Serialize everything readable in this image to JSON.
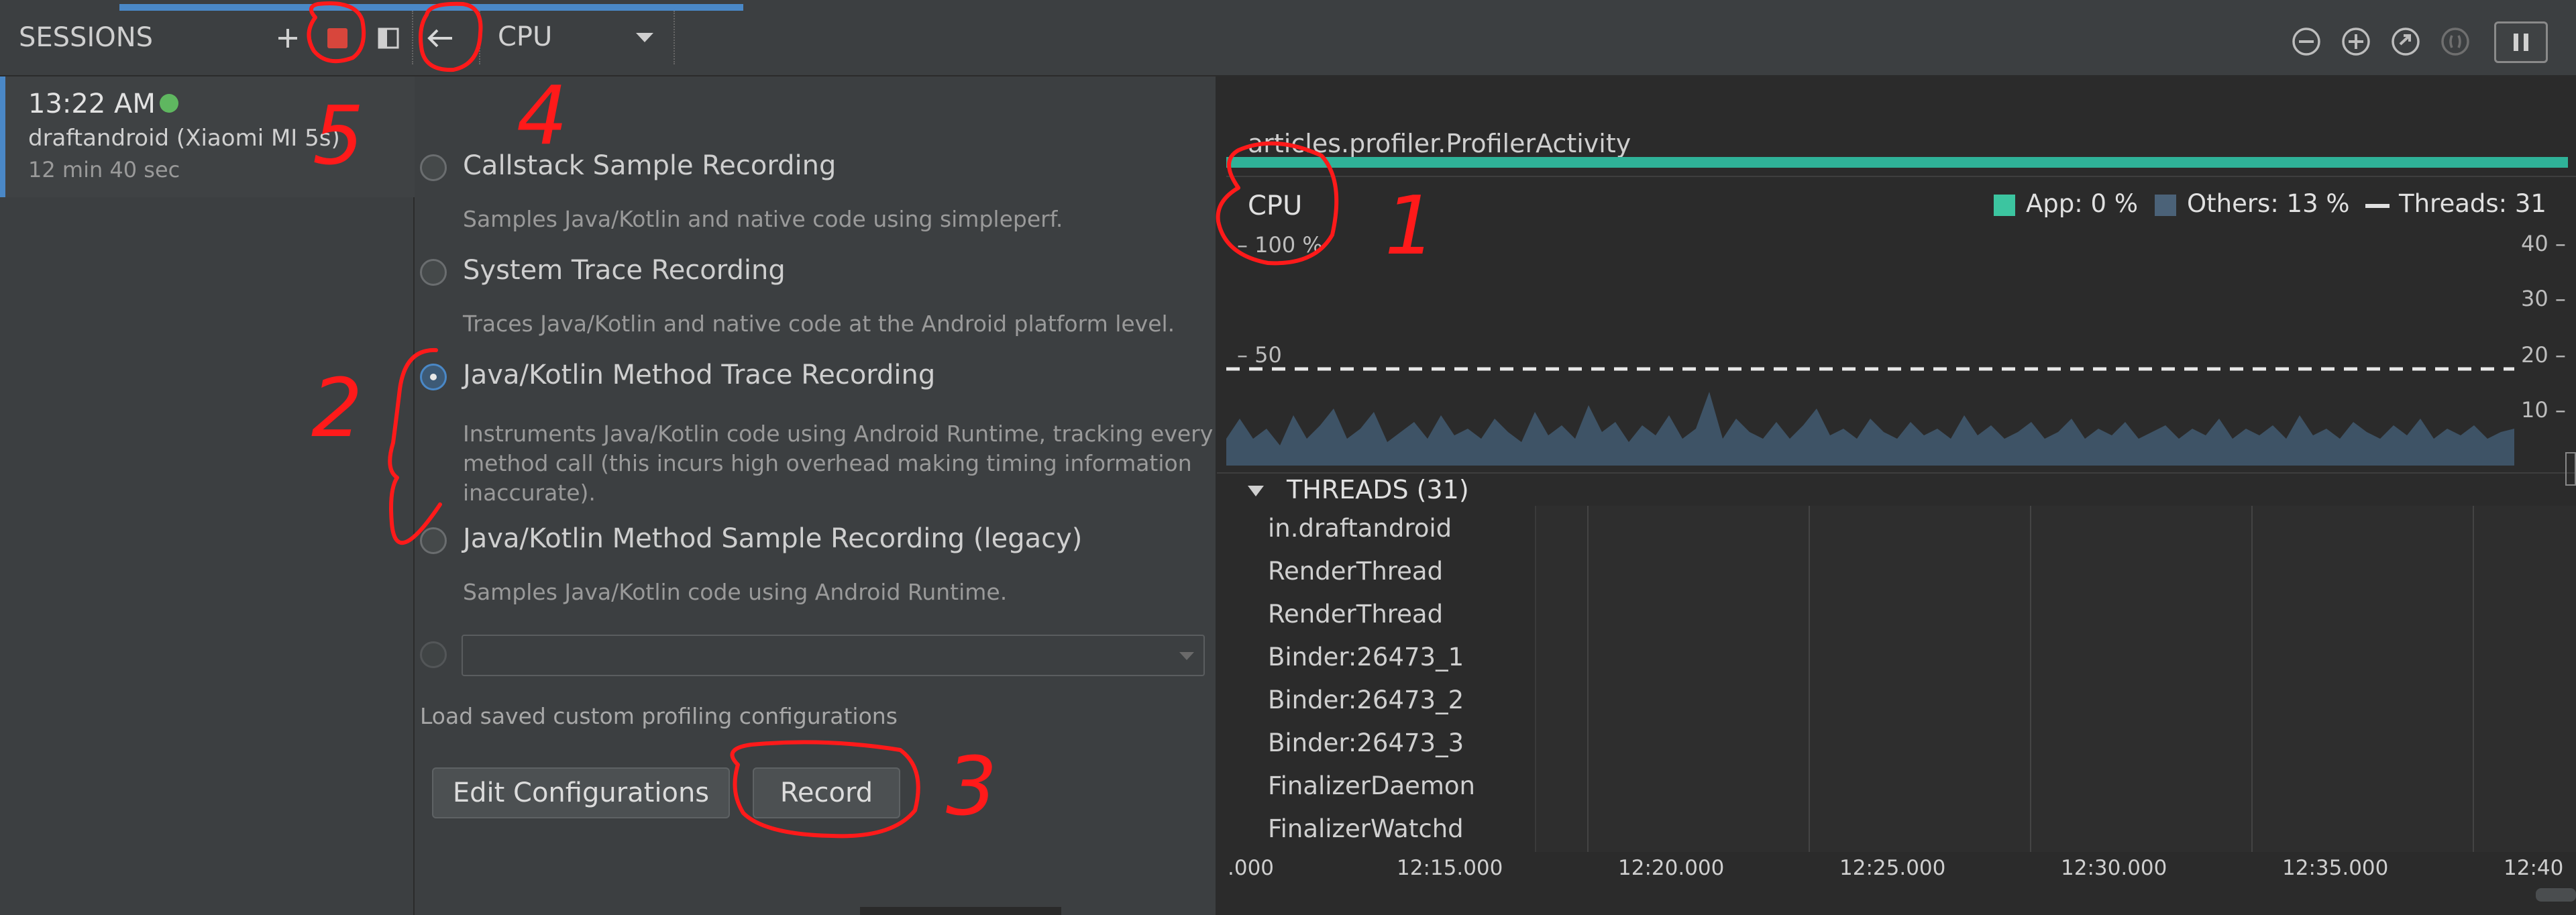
{
  "toolbar": {
    "sessions_label": "SESSIONS",
    "profiler_dropdown_value": "CPU",
    "icons": [
      "add-icon",
      "stop-icon",
      "panel-toggle-icon",
      "back-arrow-icon",
      "chevron-down-icon",
      "zoom-out-icon",
      "zoom-in-icon",
      "reset-zoom-icon",
      "zoom-to-selection-icon",
      "pause-icon"
    ]
  },
  "session": {
    "time": "13:22 AM",
    "device": "draftandroid (Xiaomi MI 5s)",
    "duration": "12 min 40 sec",
    "status_color": "#5fb760"
  },
  "config": {
    "options": [
      {
        "title": "Callstack Sample Recording",
        "description": "Samples Java/Kotlin and native code using simpleperf.",
        "selected": false
      },
      {
        "title": "System Trace Recording",
        "description": "Traces Java/Kotlin and native code at the Android platform level.",
        "selected": false
      },
      {
        "title": "Java/Kotlin Method Trace Recording",
        "description_lines": [
          "Instruments Java/Kotlin code using Android Runtime, tracking every",
          "method call (this incurs high overhead making timing information",
          "inaccurate)."
        ],
        "selected": true
      },
      {
        "title": "Java/Kotlin Method Sample Recording (legacy)",
        "description": "Samples Java/Kotlin code using Android Runtime.",
        "selected": false
      }
    ],
    "custom_config_value": "",
    "load_saved_text": "Load saved custom profiling configurations",
    "edit_button": "Edit Configurations",
    "record_button": "Record"
  },
  "monitor": {
    "activity": "articles.profiler.ProfilerActivity",
    "cpu_title": "CPU",
    "legend": {
      "app": "App: 0 %",
      "others": "Others: 13 %",
      "threads": "Threads: 31"
    },
    "left_axis": [
      "100 %",
      "50"
    ],
    "right_axis": [
      "40",
      "30",
      "20",
      "10"
    ],
    "threads_header": "THREADS (31)",
    "threads": [
      "in.draftandroid",
      "RenderThread",
      "RenderThread",
      "Binder:26473_1",
      "Binder:26473_2",
      "Binder:26473_3",
      "FinalizerDaemon",
      "FinalizerWatchd"
    ],
    "timeline_labels": [
      ".000",
      "12:15.000",
      "12:20.000",
      "12:25.000",
      "12:30.000",
      "12:35.000",
      "12:40"
    ],
    "colors": {
      "app": "#3cc5a0",
      "others": "#4b6278",
      "activity_bar": "#2fb298"
    }
  },
  "annotations": [
    "1",
    "2",
    "3",
    "4",
    "5"
  ]
}
